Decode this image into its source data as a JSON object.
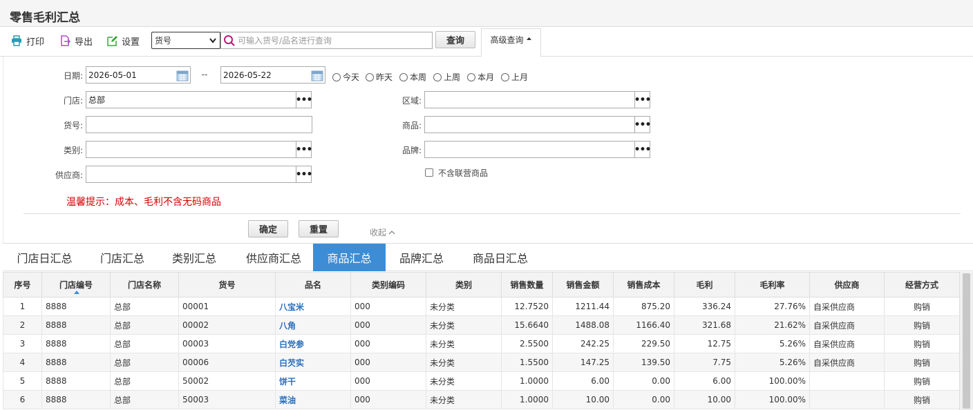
{
  "title": "零售毛利汇总",
  "toolbar": {
    "print": "打印",
    "export": "导出",
    "settings": "设置",
    "select_value": "货号",
    "search_placeholder": "可输入货号/品名进行查询",
    "query": "查询",
    "advanced": "高级查询"
  },
  "form": {
    "date_label": "日期:",
    "date_from": "2026-05-01",
    "date_sep": "--",
    "date_to": "2026-05-22",
    "quick_dates": [
      "今天",
      "昨天",
      "本周",
      "上周",
      "本月",
      "上月"
    ],
    "store_label": "门店:",
    "store_value": "总部",
    "sku_label": "货号:",
    "category_label": "类别:",
    "supplier_label": "供应商:",
    "region_label": "区域:",
    "product_label": "商品:",
    "brand_label": "品牌:",
    "exclude_joint": "不含联营商品",
    "warning": "温馨提示：成本、毛利不含无码商品",
    "confirm": "确定",
    "reset": "重置",
    "collapse": "收起"
  },
  "tabs": [
    "门店日汇总",
    "门店汇总",
    "类别汇总",
    "供应商汇总",
    "商品汇总",
    "品牌汇总",
    "商品日汇总"
  ],
  "active_tab": "商品汇总",
  "table": {
    "headers": [
      "序号",
      "门店编号",
      "门店名称",
      "货号",
      "品名",
      "类别编码",
      "类别",
      "销售数量",
      "销售金额",
      "销售成本",
      "毛利",
      "毛利率",
      "供应商",
      "经营方式"
    ],
    "rows": [
      [
        "1",
        "8888",
        "总部",
        "00001",
        "八宝米",
        "000",
        "未分类",
        "12.7520",
        "1211.44",
        "875.20",
        "336.24",
        "27.76%",
        "自采供应商",
        "购销"
      ],
      [
        "2",
        "8888",
        "总部",
        "00002",
        "八角",
        "000",
        "未分类",
        "15.6640",
        "1488.08",
        "1166.40",
        "321.68",
        "21.62%",
        "自采供应商",
        "购销"
      ],
      [
        "3",
        "8888",
        "总部",
        "00003",
        "白党参",
        "000",
        "未分类",
        "2.5500",
        "242.25",
        "229.50",
        "12.75",
        "5.26%",
        "自采供应商",
        "购销"
      ],
      [
        "4",
        "8888",
        "总部",
        "00006",
        "白芡实",
        "000",
        "未分类",
        "1.5500",
        "147.25",
        "139.50",
        "7.75",
        "5.26%",
        "自采供应商",
        "购销"
      ],
      [
        "5",
        "8888",
        "总部",
        "50002",
        "饼干",
        "000",
        "未分类",
        "1.0000",
        "6.00",
        "0.00",
        "6.00",
        "100.00%",
        "",
        "购销"
      ],
      [
        "6",
        "8888",
        "总部",
        "50003",
        "菜油",
        "000",
        "未分类",
        "1.0000",
        "10.00",
        "0.00",
        "10.00",
        "100.00%",
        "",
        "购销"
      ]
    ]
  },
  "colors": {
    "accent": "#3c8dd6",
    "warning": "#d40000",
    "link": "#2a6ebb"
  }
}
